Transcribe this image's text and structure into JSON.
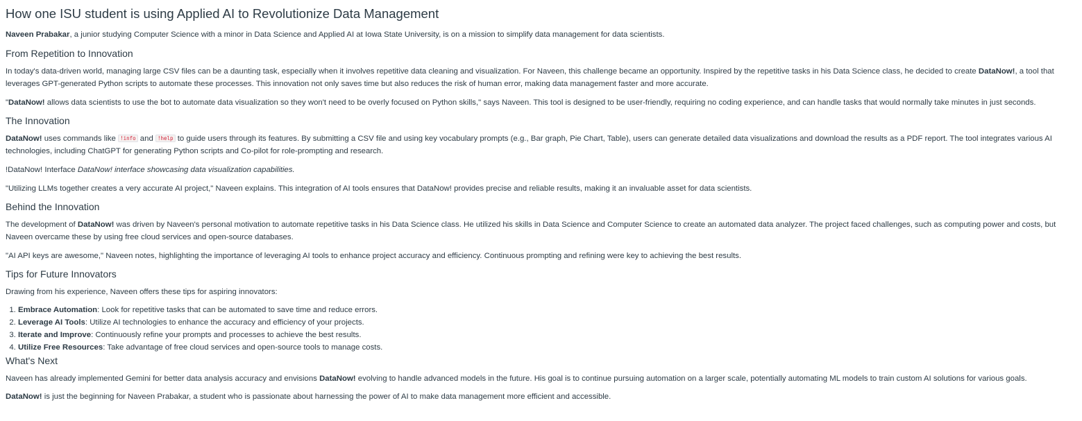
{
  "article": {
    "title": "How one ISU student is using Applied AI to Revolutionize Data Management",
    "intro": {
      "name": "Naveen Prabakar",
      "text": ", a junior studying Computer Science with a minor in Data Science and Applied AI at Iowa State University, is on a mission to simplify data management for data scientists."
    },
    "section1": {
      "heading": "From Repetition to Innovation",
      "p1_a": "In today's data-driven world, managing large CSV files can be a daunting task, especially when it involves repetitive data cleaning and visualization. For Naveen, this challenge became an opportunity. Inspired by the repetitive tasks in his Data Science class, he decided to create ",
      "p1_brand": "DataNow!",
      "p1_b": ", a tool that leverages GPT-generated Python scripts to automate these processes. This innovation not only saves time but also reduces the risk of human error, making data management faster and more accurate.",
      "p2_open": "\"",
      "p2_brand": "DataNow!",
      "p2_rest": " allows data scientists to use the bot to automate data visualization so they won't need to be overly focused on Python skills,\" says Naveen. This tool is designed to be user-friendly, requiring no coding experience, and can handle tasks that would normally take minutes in just seconds."
    },
    "section2": {
      "heading": "The Innovation",
      "brand": "DataNow!",
      "p1_a": " uses commands like ",
      "cmd_info": "!info",
      "p1_and": " and ",
      "cmd_help": "!help",
      "p1_b": " to guide users through its features. By submitting a CSV file and using key vocabulary prompts (e.g., Bar graph, Pie Chart, Table), users can generate detailed data visualizations and download the results as a PDF report. The tool integrates various AI technologies, including ChatGPT for generating Python scripts and Co-pilot for role-prompting and research.",
      "image_alt": "!DataNow! Interface ",
      "image_caption": "DataNow! interface showcasing data visualization capabilities.",
      "quote": "\"Utilizing LLMs together creates a very accurate AI project,\" Naveen explains. This integration of AI tools ensures that DataNow! provides precise and reliable results, making it an invaluable asset for data scientists."
    },
    "section3": {
      "heading": "Behind the Innovation",
      "p1_a": "The development of ",
      "p1_brand": "DataNow!",
      "p1_b": " was driven by Naveen's personal motivation to automate repetitive tasks in his Data Science class. He utilized his skills in Data Science and Computer Science to create an automated data analyzer. The project faced challenges, such as computing power and costs, but Naveen overcame these by using free cloud services and open-source databases.",
      "quote": "\"AI API keys are awesome,\" Naveen notes, highlighting the importance of leveraging AI tools to enhance project accuracy and efficiency. Continuous prompting and refining were key to achieving the best results."
    },
    "section4": {
      "heading": "Tips for Future Innovators",
      "intro": "Drawing from his experience, Naveen offers these tips for aspiring innovators:",
      "tips": [
        {
          "title": "Embrace Automation",
          "text": ": Look for repetitive tasks that can be automated to save time and reduce errors."
        },
        {
          "title": "Leverage AI Tools",
          "text": ": Utilize AI technologies to enhance the accuracy and efficiency of your projects."
        },
        {
          "title": "Iterate and Improve",
          "text": ": Continuously refine your prompts and processes to achieve the best results."
        },
        {
          "title": "Utilize Free Resources",
          "text": ": Take advantage of free cloud services and open-source tools to manage costs."
        }
      ]
    },
    "section5": {
      "heading": "What's Next",
      "p1_a": "Naveen has already implemented Gemini for better data analysis accuracy and envisions ",
      "p1_brand": "DataNow!",
      "p1_b": " evolving to handle advanced models in the future. His goal is to continue pursuing automation on a larger scale, potentially automating ML models to train custom AI solutions for various goals.",
      "p2_brand": "DataNow!",
      "p2_rest": " is just the beginning for Naveen Prabakar, a student who is passionate about harnessing the power of AI to make data management more efficient and accessible."
    }
  }
}
